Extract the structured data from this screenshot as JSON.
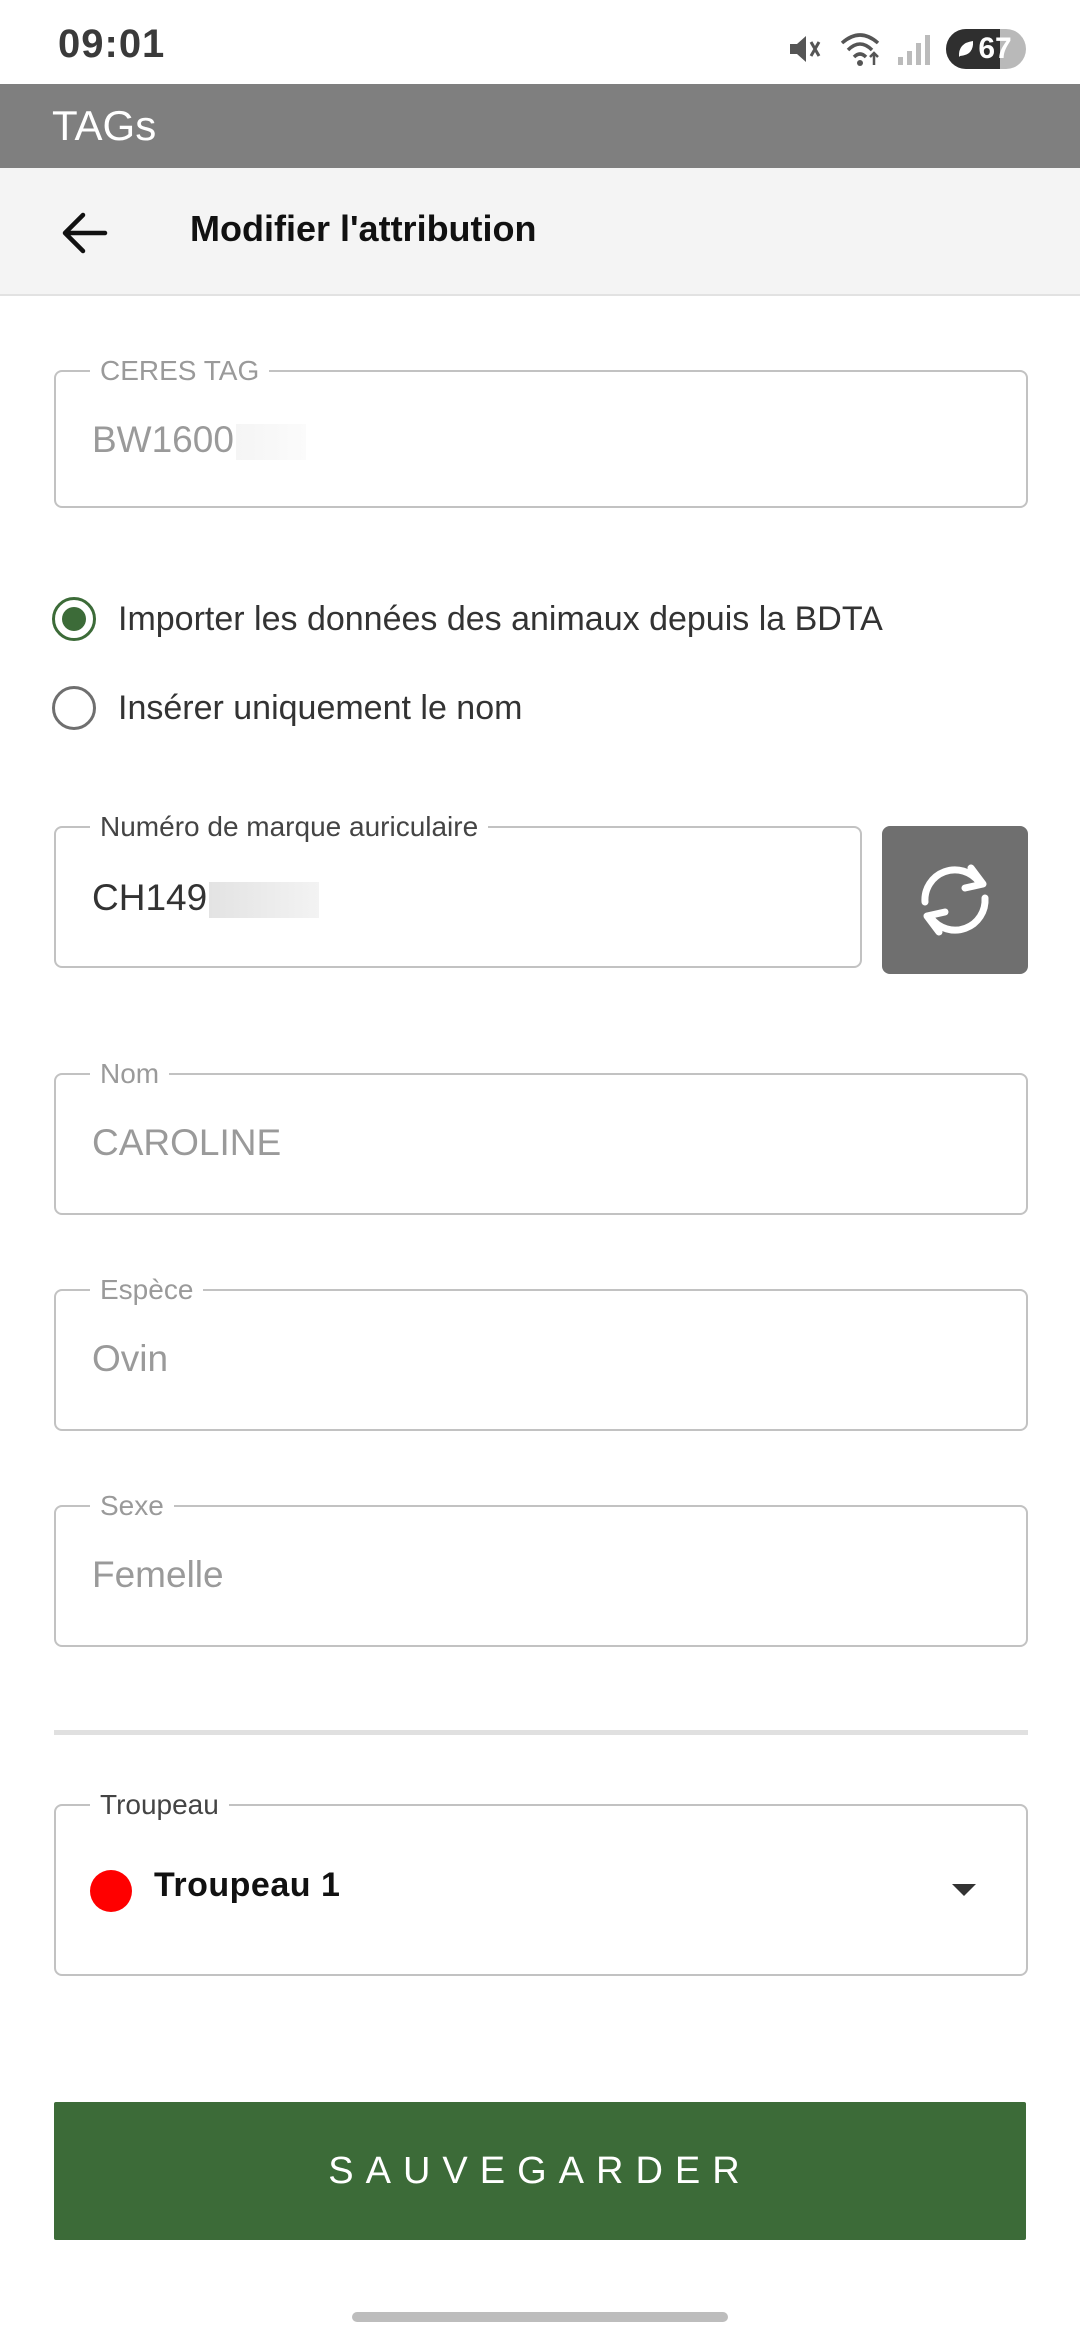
{
  "status_bar": {
    "time": "09:01",
    "battery_level": "67",
    "battery_fraction": 0.67,
    "icons": [
      "mute-icon",
      "wifi-icon",
      "signal-icon",
      "battery-icon"
    ]
  },
  "app_bar": {
    "title": "TAGs"
  },
  "header": {
    "back_icon": "arrow-left-icon",
    "title": "Modifier l'attribution"
  },
  "form": {
    "ceres_tag": {
      "label": "CERES TAG",
      "value": "BW1600"
    },
    "import_mode": {
      "options": [
        {
          "label": "Importer les données des animaux depuis la BDTA",
          "selected": true
        },
        {
          "label": "Insérer uniquement le nom",
          "selected": false
        }
      ]
    },
    "ear_tag": {
      "label": "Numéro de marque auriculaire",
      "value": "CH149",
      "refresh_icon": "refresh-icon"
    },
    "name": {
      "label": "Nom",
      "value": "CAROLINE"
    },
    "species": {
      "label": "Espèce",
      "value": "Ovin"
    },
    "sex": {
      "label": "Sexe",
      "value": "Femelle"
    },
    "herd": {
      "label": "Troupeau",
      "value": "Troupeau 1",
      "color": "#ff0000"
    }
  },
  "actions": {
    "save_label": "SAUVEGARDER"
  },
  "colors": {
    "accent": "#3c6b38",
    "app_bar": "#7f7f7f",
    "refresh_button": "#6f6f6f"
  }
}
